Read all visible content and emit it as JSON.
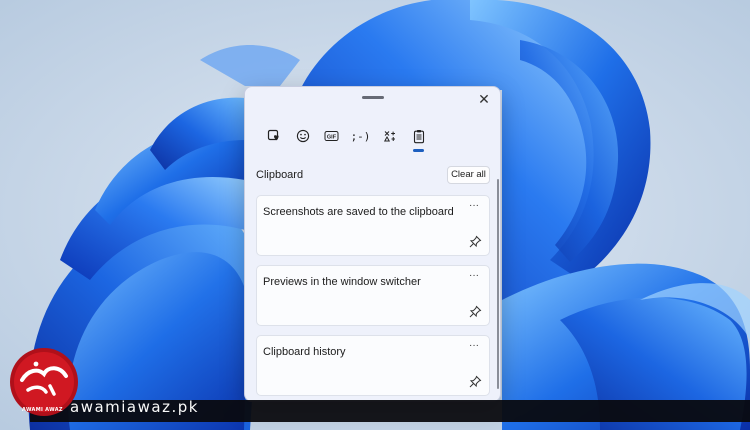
{
  "clipboard_panel": {
    "close_icon": "close-icon",
    "tabs": [
      {
        "icon": "emoji-heart-icon",
        "active": false
      },
      {
        "icon": "smiley-icon",
        "active": false
      },
      {
        "icon": "gif-icon",
        "label": "GIF",
        "active": false
      },
      {
        "icon": "kaomoji-icon",
        "label": ";-)",
        "active": false
      },
      {
        "icon": "symbols-icon",
        "active": false
      },
      {
        "icon": "clipboard-icon",
        "active": true
      }
    ],
    "section_title": "Clipboard",
    "clear_all_label": "Clear all",
    "items": [
      {
        "text": "Screenshots are saved to the clipboard",
        "more_label": "···",
        "pin_icon": "pin-icon"
      },
      {
        "text": "Previews in the window switcher",
        "more_label": "···",
        "pin_icon": "pin-icon"
      },
      {
        "text": "Clipboard history",
        "more_label": "···",
        "pin_icon": "pin-icon"
      }
    ]
  },
  "watermark": {
    "site": "awamiawaz.pk",
    "logo_caption": "AWAMI AWAZ"
  },
  "colors": {
    "accent": "#1d5fbf",
    "panel_bg": "#eef1fb",
    "wallpaper_bg": "#c9d8ea",
    "bloom_blue": "#1a5fe0"
  }
}
